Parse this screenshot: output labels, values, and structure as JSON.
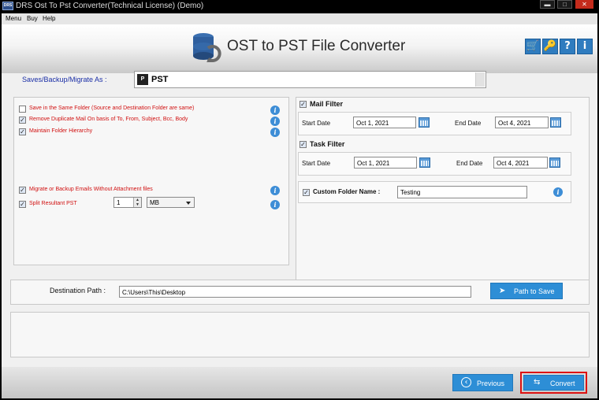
{
  "window": {
    "title": "DRS Ost To Pst Converter(Technical License) (Demo)",
    "icon_text": "DRS",
    "minimize": "▬",
    "maximize": "□",
    "close": "✕"
  },
  "menu": [
    "Menu",
    "Buy",
    "Help"
  ],
  "header": {
    "title": "OST to PST File Converter",
    "buttons": [
      {
        "name": "cart-icon",
        "glyph": "🛒"
      },
      {
        "name": "key-icon",
        "glyph": "🔑"
      },
      {
        "name": "help-icon",
        "glyph": "?"
      },
      {
        "name": "info-icon",
        "glyph": "i"
      }
    ]
  },
  "saves": {
    "label": "Saves/Backup/Migrate As :",
    "pst_icon": "P",
    "value": "PST"
  },
  "options": [
    {
      "label": "Save in the Same Folder (Source and Destination Folder are same)",
      "checked": false
    },
    {
      "label": "Remove Duplicate Mail On basis of To, From, Subject, Bcc, Body",
      "checked": true
    },
    {
      "label": "Maintain Folder Hierarchy",
      "checked": true
    },
    {
      "label": "Migrate or Backup Emails Without Attachment files",
      "checked": true
    },
    {
      "label": "Split Resultant PST",
      "checked": true
    }
  ],
  "split": {
    "value": "1",
    "unit": "MB",
    "spin_up": "▲",
    "spin_down": "▼"
  },
  "info_glyph": "i",
  "check_glyph": "✓",
  "mail_filter": {
    "title": "Mail Filter",
    "start_label": "Start Date",
    "start_value": "Oct 1, 2021",
    "end_label": "End Date",
    "end_value": "Oct 4, 2021"
  },
  "task_filter": {
    "title": "Task Filter",
    "start_label": "Start Date",
    "start_value": "Oct 1, 2021",
    "end_label": "End Date",
    "end_value": "Oct 4, 2021"
  },
  "custom_folder": {
    "title": "Custom Folder Name :",
    "value": "Testing"
  },
  "destination": {
    "label": "Destination Path :",
    "value": "C:\\Users\\This\\Desktop",
    "button": "Path to Save",
    "button_icon": "➤"
  },
  "footer": {
    "previous": "Previous",
    "previous_icon": "‹",
    "convert": "Convert",
    "convert_icon": "⇆"
  },
  "colors": {
    "accent": "#2d8ed6",
    "option_text": "#d11111",
    "label_blue": "#1a2ea6",
    "highlight_border": "#dd1111"
  }
}
